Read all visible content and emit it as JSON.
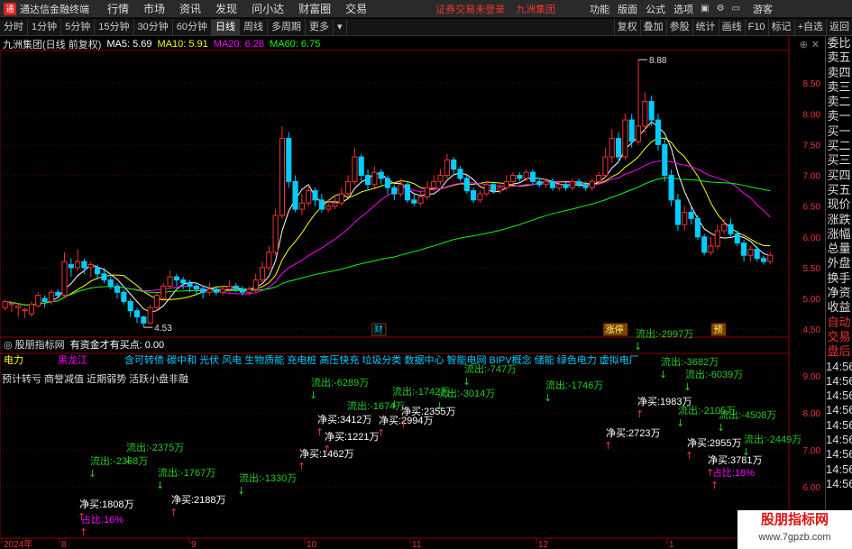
{
  "titlebar": {
    "app_name": "通达信金融终端",
    "menus": [
      "行情",
      "市场",
      "资讯",
      "发现",
      "问小达",
      "财富圈",
      "交易"
    ],
    "notice": "证券交易未登录",
    "stock_name": "九洲集团",
    "right_menus": [
      "功能",
      "版面",
      "公式",
      "选项"
    ],
    "user": "游客"
  },
  "toolbar": {
    "periods": [
      "分时",
      "1分钟",
      "5分钟",
      "15分钟",
      "30分钟",
      "60分钟",
      "日线",
      "周线",
      "多周期",
      "更多"
    ],
    "active_period": "日线",
    "right_items": [
      "复权",
      "叠加",
      "参股",
      "统计",
      "画线",
      "F10",
      "标记",
      "+自选",
      "返回"
    ]
  },
  "info": {
    "stock_label": "九洲集团(日线 前复权)",
    "ma5": "MA5: 5.69",
    "ma10": "MA10: 5.91",
    "ma20": "MA20: 6.28",
    "ma60": "MA60: 6.75"
  },
  "price_axis": [
    "8.50",
    "8.00",
    "7.50",
    "7.00",
    "6.50",
    "6.00",
    "5.50",
    "5.00",
    "4.50"
  ],
  "lower_axis": [
    "9.00",
    "8.00",
    "7.00",
    "6.00"
  ],
  "markers": {
    "high": "8.88",
    "low": "4.53",
    "events": [
      "财",
      "涨停",
      "预"
    ]
  },
  "x_axis": [
    "2024年",
    "8",
    "9",
    "10",
    "11",
    "12",
    "1"
  ],
  "lower_panel": {
    "title": "股朋指标网",
    "indicator": "有资金才有买点: 0.00",
    "sector": "电力",
    "region": "黑龙江",
    "concepts": "含可转债 碳中和 光伏 风电 生物质能 充电桩 高压快充 垃圾分类 数据中心 智能电网 BIPV概念 储能 绿色电力 虚拟电厂",
    "risk_text": "预计转亏 商誉减值 近期弱势 活跃小盘非融"
  },
  "flow_labels": [
    {
      "t": "流出:-2368万",
      "c": "g"
    },
    {
      "t": "流出:-2375万",
      "c": "g"
    },
    {
      "t": "流出:-6289万",
      "c": "g"
    },
    {
      "t": "流出:-747万",
      "c": "g"
    },
    {
      "t": "流出:-1674万",
      "c": "g"
    },
    {
      "t": "流出:-1742万",
      "c": "g"
    },
    {
      "t": "流出:-3014万",
      "c": "g"
    },
    {
      "t": "流出:-1746万",
      "c": "g"
    },
    {
      "t": "流出:-2997万",
      "c": "g"
    },
    {
      "t": "流出:-3682万",
      "c": "g"
    },
    {
      "t": "流出:-6039万",
      "c": "g"
    },
    {
      "t": "流出:-2105万",
      "c": "g"
    },
    {
      "t": "流出:-4508万",
      "c": "g"
    },
    {
      "t": "流出:-2449万",
      "c": "g"
    },
    {
      "t": "流出:-1767万",
      "c": "g"
    },
    {
      "t": "流出:-1330万",
      "c": "g"
    },
    {
      "t": "净买:1808万",
      "c": "w"
    },
    {
      "t": "净买:2188万",
      "c": "w"
    },
    {
      "t": "净买:1221万",
      "c": "w"
    },
    {
      "t": "净买:1462万",
      "c": "w"
    },
    {
      "t": "净买:3412万",
      "c": "w"
    },
    {
      "t": "净买:2994万",
      "c": "w"
    },
    {
      "t": "净买:2355万",
      "c": "w"
    },
    {
      "t": "净买:2723万",
      "c": "w"
    },
    {
      "t": "净买:2955万",
      "c": "w"
    },
    {
      "t": "净买:3781万",
      "c": "w"
    },
    {
      "t": "净买:1983万",
      "c": "w"
    },
    {
      "t": "占比:16%",
      "c": "m"
    },
    {
      "t": "占比:18%",
      "c": "m"
    }
  ],
  "right_panel": [
    "委比",
    "卖五",
    "卖四",
    "卖三",
    "卖二",
    "卖一",
    "买一",
    "买二",
    "买三",
    "买四",
    "买五",
    "现价",
    "涨跌",
    "涨幅",
    "总量",
    "外盘",
    "换手",
    "净资",
    "收益",
    "自动",
    "交易",
    "盘后",
    "14:56",
    "14:56",
    "14:56",
    "14:56",
    "14:56",
    "14:56",
    "14:56",
    "14:56",
    "14:56"
  ],
  "watermark": {
    "line1": "股朋指标网",
    "line2": "www.7gpzb.com"
  },
  "colors": {
    "up": "#e33",
    "down": "#0cf",
    "ma5": "#fff",
    "ma10": "#ff0",
    "ma20": "#f0f",
    "ma60": "#0f0",
    "flow_out": "#2c2",
    "net_buy": "#fff",
    "ratio": "#f0f"
  },
  "chart_data": {
    "type": "candlestick",
    "ylim": [
      4.4,
      9.0
    ],
    "candles": [
      [
        4.85,
        4.95,
        4.8,
        4.98
      ],
      [
        4.9,
        4.92,
        4.78,
        4.95
      ],
      [
        4.85,
        4.88,
        4.7,
        4.92
      ],
      [
        4.8,
        4.82,
        4.68,
        4.85
      ],
      [
        4.75,
        4.9,
        4.7,
        4.95
      ],
      [
        4.88,
        5.05,
        4.85,
        5.1
      ],
      [
        5.0,
        4.95,
        4.85,
        5.05
      ],
      [
        4.95,
        5.1,
        4.9,
        5.15
      ],
      [
        5.1,
        5.05,
        5.0,
        5.15
      ],
      [
        5.05,
        5.6,
        5.0,
        5.75
      ],
      [
        5.55,
        5.5,
        5.35,
        5.65
      ],
      [
        5.5,
        5.6,
        5.45,
        5.8
      ],
      [
        5.6,
        5.5,
        5.4,
        5.65
      ],
      [
        5.5,
        5.55,
        5.35,
        5.6
      ],
      [
        5.5,
        5.4,
        5.3,
        5.55
      ],
      [
        5.4,
        5.3,
        5.25,
        5.5
      ],
      [
        5.3,
        5.2,
        5.15,
        5.4
      ],
      [
        5.2,
        5.1,
        5.0,
        5.25
      ],
      [
        5.1,
        4.95,
        4.9,
        5.15
      ],
      [
        4.95,
        4.8,
        4.7,
        5.0
      ],
      [
        4.8,
        4.7,
        4.6,
        4.85
      ],
      [
        4.7,
        4.6,
        4.53,
        4.72
      ],
      [
        4.6,
        4.85,
        4.58,
        4.9
      ],
      [
        4.85,
        5.05,
        4.8,
        5.1
      ],
      [
        5.0,
        5.2,
        4.98,
        5.25
      ],
      [
        5.2,
        5.35,
        5.15,
        5.45
      ],
      [
        5.35,
        5.3,
        5.2,
        5.4
      ],
      [
        5.3,
        5.25,
        5.15,
        5.35
      ],
      [
        5.25,
        5.2,
        5.1,
        5.3
      ],
      [
        5.2,
        5.15,
        5.05,
        5.25
      ],
      [
        5.15,
        5.1,
        5.0,
        5.2
      ],
      [
        5.1,
        5.15,
        5.05,
        5.25
      ],
      [
        5.15,
        5.1,
        5.05,
        5.2
      ],
      [
        5.1,
        5.15,
        5.05,
        5.2
      ],
      [
        5.15,
        5.2,
        5.1,
        5.3
      ],
      [
        5.2,
        5.15,
        5.1,
        5.25
      ],
      [
        5.15,
        5.1,
        5.05,
        5.2
      ],
      [
        5.1,
        5.15,
        5.05,
        5.2
      ],
      [
        5.15,
        5.3,
        5.1,
        5.4
      ],
      [
        5.3,
        5.5,
        5.25,
        5.6
      ],
      [
        5.5,
        5.75,
        5.45,
        5.85
      ],
      [
        5.75,
        6.35,
        5.7,
        6.45
      ],
      [
        6.35,
        7.6,
        6.3,
        7.8
      ],
      [
        7.6,
        6.9,
        6.8,
        7.7
      ],
      [
        6.9,
        6.45,
        6.4,
        7.0
      ],
      [
        6.45,
        6.55,
        6.35,
        6.7
      ],
      [
        6.55,
        6.75,
        6.5,
        6.85
      ],
      [
        6.75,
        6.6,
        6.5,
        6.8
      ],
      [
        6.6,
        6.45,
        6.4,
        6.7
      ],
      [
        6.45,
        6.5,
        6.4,
        6.6
      ],
      [
        6.5,
        6.55,
        6.45,
        6.65
      ],
      [
        6.55,
        6.7,
        6.5,
        6.8
      ],
      [
        6.7,
        6.9,
        6.65,
        7.0
      ],
      [
        6.9,
        7.3,
        6.85,
        7.45
      ],
      [
        7.3,
        7.0,
        6.9,
        7.35
      ],
      [
        7.0,
        6.85,
        6.75,
        7.1
      ],
      [
        6.85,
        7.05,
        6.8,
        7.15
      ],
      [
        7.05,
        6.95,
        6.85,
        7.1
      ],
      [
        6.95,
        6.8,
        6.7,
        7.0
      ],
      [
        6.8,
        6.7,
        6.6,
        6.85
      ],
      [
        6.7,
        6.85,
        6.65,
        6.95
      ],
      [
        6.85,
        6.6,
        6.55,
        6.9
      ],
      [
        6.6,
        6.55,
        6.5,
        6.7
      ],
      [
        6.55,
        6.65,
        6.5,
        6.75
      ],
      [
        6.65,
        6.8,
        6.6,
        6.9
      ],
      [
        6.8,
        6.9,
        6.75,
        7.0
      ],
      [
        6.9,
        7.0,
        6.85,
        7.1
      ],
      [
        7.0,
        7.25,
        6.95,
        7.35
      ],
      [
        7.25,
        7.1,
        7.0,
        7.3
      ],
      [
        7.1,
        6.95,
        6.9,
        7.15
      ],
      [
        6.95,
        6.75,
        6.7,
        7.0
      ],
      [
        6.75,
        6.6,
        6.55,
        6.8
      ],
      [
        6.6,
        6.7,
        6.55,
        6.75
      ],
      [
        6.7,
        6.85,
        6.65,
        6.9
      ],
      [
        6.85,
        6.75,
        6.7,
        6.9
      ],
      [
        6.75,
        6.8,
        6.7,
        6.85
      ],
      [
        6.8,
        6.9,
        6.75,
        7.0
      ],
      [
        6.9,
        7.0,
        6.85,
        7.05
      ],
      [
        7.0,
        6.95,
        6.9,
        7.05
      ],
      [
        6.95,
        7.05,
        6.9,
        7.1
      ],
      [
        7.05,
        6.9,
        6.85,
        7.1
      ],
      [
        6.9,
        6.85,
        6.8,
        6.95
      ],
      [
        6.85,
        6.9,
        6.8,
        6.95
      ],
      [
        6.9,
        6.8,
        6.75,
        6.95
      ],
      [
        6.8,
        6.85,
        6.75,
        6.9
      ],
      [
        6.85,
        6.8,
        6.75,
        6.9
      ],
      [
        6.8,
        6.9,
        6.75,
        6.95
      ],
      [
        6.9,
        6.85,
        6.8,
        6.95
      ],
      [
        6.85,
        6.8,
        6.75,
        6.9
      ],
      [
        6.8,
        6.9,
        6.75,
        6.95
      ],
      [
        6.9,
        7.0,
        6.85,
        7.05
      ],
      [
        7.0,
        7.3,
        6.95,
        7.45
      ],
      [
        7.3,
        7.6,
        7.2,
        7.75
      ],
      [
        7.6,
        7.3,
        7.2,
        7.7
      ],
      [
        7.3,
        7.9,
        7.25,
        8.0
      ],
      [
        7.9,
        7.55,
        7.45,
        8.0
      ],
      [
        7.55,
        7.8,
        7.5,
        8.88
      ],
      [
        7.8,
        8.2,
        7.7,
        8.35
      ],
      [
        8.2,
        7.9,
        7.8,
        8.3
      ],
      [
        7.9,
        7.5,
        7.4,
        8.0
      ],
      [
        7.5,
        7.0,
        6.9,
        7.6
      ],
      [
        7.0,
        6.6,
        6.5,
        7.1
      ],
      [
        6.6,
        6.2,
        6.1,
        6.7
      ],
      [
        6.2,
        6.4,
        6.1,
        6.5
      ],
      [
        6.4,
        6.3,
        6.2,
        6.5
      ],
      [
        6.3,
        6.0,
        5.95,
        6.35
      ],
      [
        6.0,
        5.75,
        5.7,
        6.05
      ],
      [
        5.75,
        5.85,
        5.7,
        6.0
      ],
      [
        5.85,
        6.1,
        5.8,
        6.2
      ],
      [
        6.1,
        6.2,
        6.05,
        6.3
      ],
      [
        6.2,
        6.05,
        6.0,
        6.3
      ],
      [
        6.05,
        5.9,
        5.85,
        6.1
      ],
      [
        5.9,
        5.7,
        5.6,
        5.95
      ],
      [
        5.7,
        5.8,
        5.6,
        5.85
      ],
      [
        5.8,
        5.65,
        5.6,
        5.85
      ],
      [
        5.65,
        5.6,
        5.55,
        5.7
      ],
      [
        5.6,
        5.7,
        5.55,
        5.75
      ]
    ]
  }
}
